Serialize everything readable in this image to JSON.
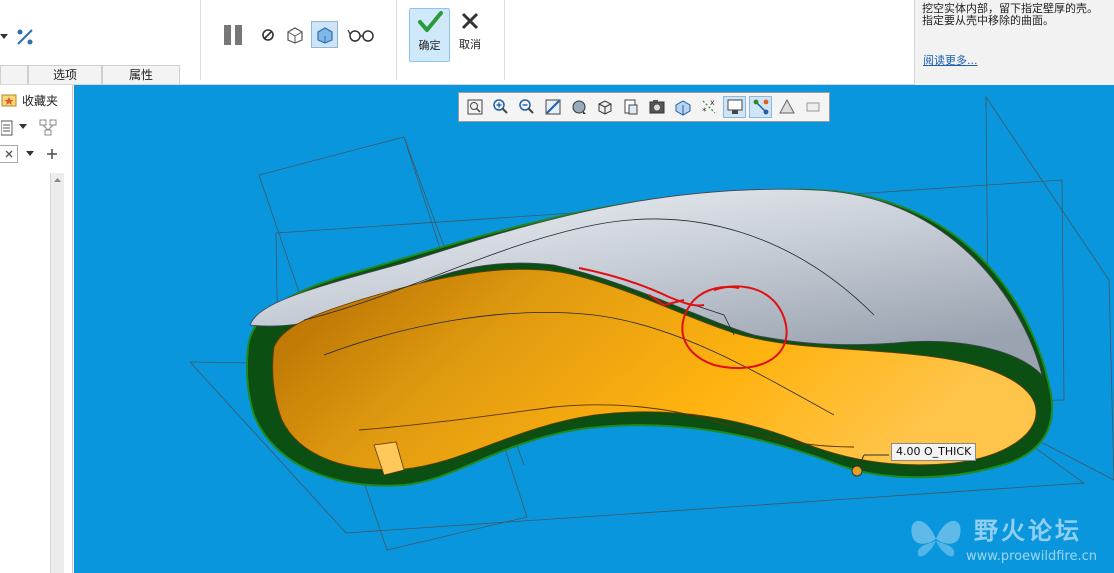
{
  "ribbon": {
    "tabs": [
      "选项",
      "属性"
    ],
    "ok_label": "确定",
    "cancel_label": "取消",
    "hint_text": "挖空实体内部，留下指定壁厚的壳。指定要从壳中移除的曲面。",
    "hint_link": "阅读更多..."
  },
  "left_panel": {
    "favorites_label": "收藏夹"
  },
  "viewport": {
    "background_color": "#0a96dc",
    "view_toolbar_icons": [
      "refit-icon",
      "zoom-in-icon",
      "zoom-out-icon",
      "repaint-icon",
      "display-style-icon",
      "saved-views-icon",
      "view-manager-icon",
      "perspective-icon",
      "section-icon",
      "datum-display-icon",
      "annotation-display-icon",
      "spin-center-icon",
      "point-display-icon",
      "csys-display-icon"
    ],
    "dimension_label": "4.00 O_THICK",
    "watermark_title": "野火论坛",
    "watermark_url": "www.proewildfire.cn"
  }
}
